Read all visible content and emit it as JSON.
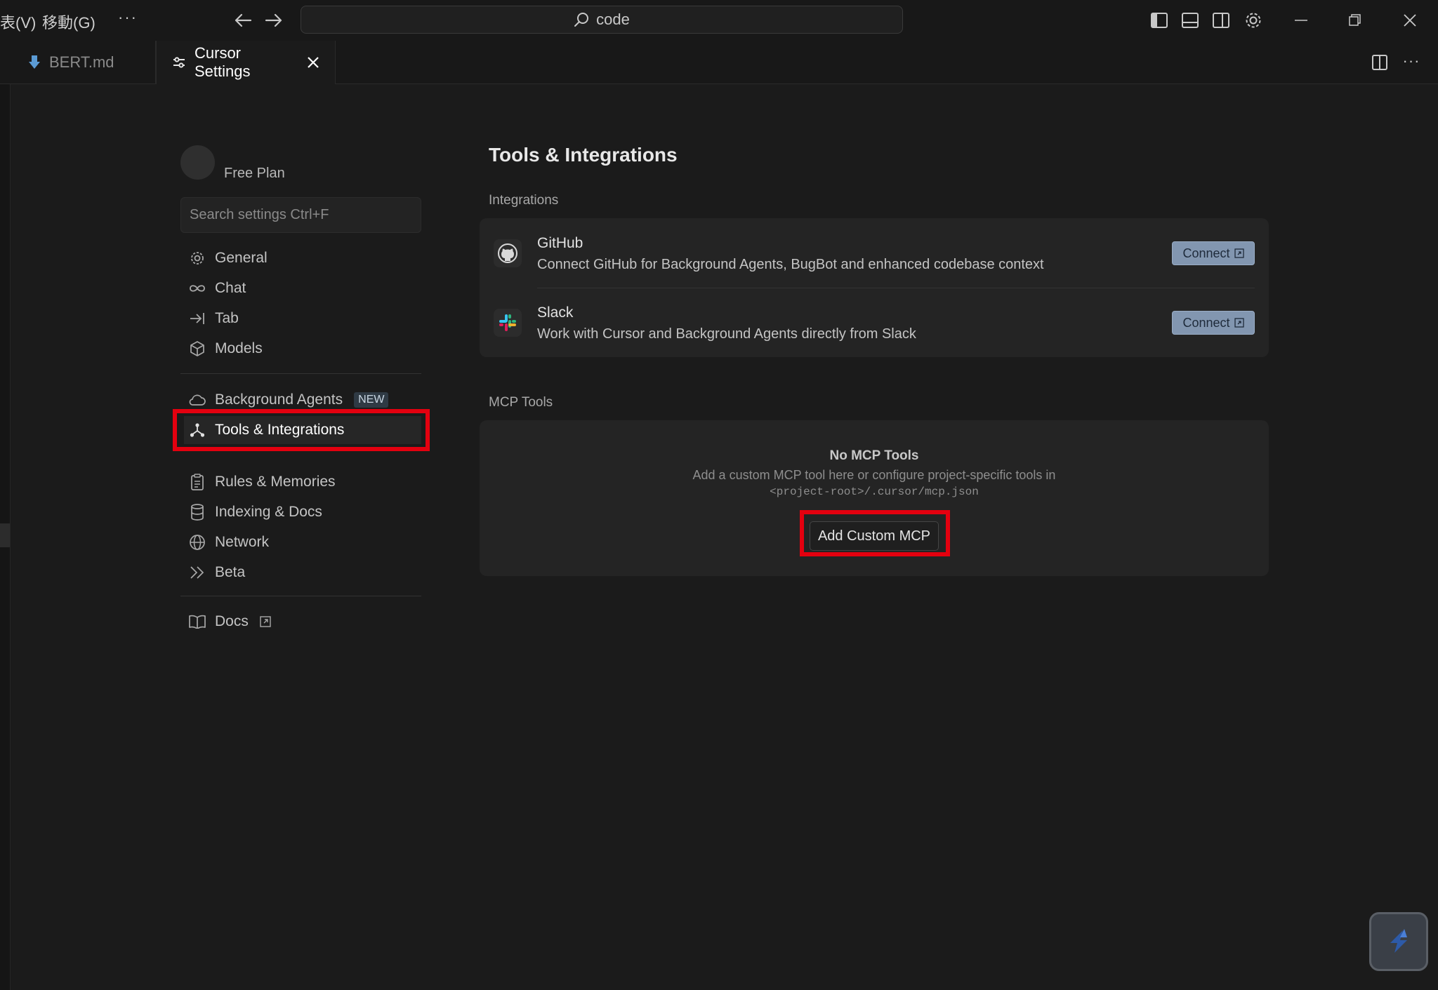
{
  "titlebar": {
    "menu_view": "表(V)",
    "menu_go": "移動(G)",
    "more": "···",
    "search_text": "code"
  },
  "tabs": {
    "bert_label": "BERT.md",
    "settings_label": "Cursor Settings"
  },
  "sidebar": {
    "plan": "Free Plan",
    "search_placeholder": "Search settings Ctrl+F",
    "items": [
      {
        "label": "General",
        "icon": "gear-icon"
      },
      {
        "label": "Chat",
        "icon": "infinity-icon"
      },
      {
        "label": "Tab",
        "icon": "arrow-right-bar-icon"
      },
      {
        "label": "Models",
        "icon": "cube-icon"
      },
      {
        "label": "Background Agents",
        "icon": "cloud-icon",
        "badge": "NEW"
      },
      {
        "label": "Tools & Integrations",
        "icon": "tools-icon",
        "active": true
      },
      {
        "label": "Rules & Memories",
        "icon": "clipboard-icon"
      },
      {
        "label": "Indexing & Docs",
        "icon": "database-icon"
      },
      {
        "label": "Network",
        "icon": "globe-icon"
      },
      {
        "label": "Beta",
        "icon": "chevrons-right-icon"
      },
      {
        "label": "Docs",
        "icon": "book-icon",
        "external": true
      }
    ]
  },
  "main": {
    "title": "Tools & Integrations",
    "integrations_label": "Integrations",
    "integrations": [
      {
        "name": "GitHub",
        "description": "Connect GitHub for Background Agents, BugBot and enhanced codebase context",
        "button": "Connect"
      },
      {
        "name": "Slack",
        "description": "Work with Cursor and Background Agents directly from Slack",
        "button": "Connect"
      }
    ],
    "mcp_label": "MCP Tools",
    "mcp_empty_title": "No MCP Tools",
    "mcp_empty_desc": "Add a custom MCP tool here or configure project-specific tools in",
    "mcp_path": "<project-root>/.cursor/mcp.json",
    "add_button": "Add Custom MCP"
  },
  "colors": {
    "highlight": "#e4000f",
    "connect_button": "#8296b0"
  }
}
